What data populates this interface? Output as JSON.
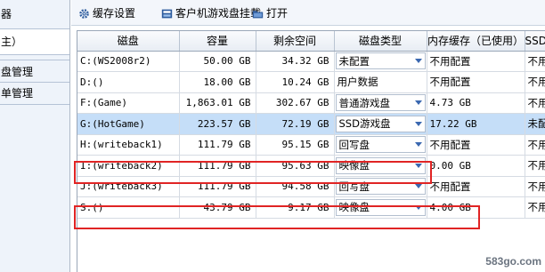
{
  "sidebar": {
    "title_fragment": "器",
    "selected_fragment": "主）",
    "items": [
      {
        "label": "盘管理"
      },
      {
        "label": "单管理"
      }
    ]
  },
  "toolbar": {
    "cache_settings": "缓存设置",
    "client_mount": "客户机游戏盘挂载",
    "open": "打开"
  },
  "grid": {
    "columns": [
      "磁盘",
      "容量",
      "剩余空间",
      "磁盘类型",
      "内存缓存（已使用）",
      "SSD缓存"
    ],
    "rows": [
      {
        "disk": "C:(WS2008r2)",
        "capacity": "50.00 GB",
        "free": "34.32 GB",
        "type": "未配置",
        "type_dropdown": true,
        "mem_cache": "不用配置",
        "ssd_cache": "不用配"
      },
      {
        "disk": "D:()",
        "capacity": "18.00 GB",
        "free": "10.24 GB",
        "type": "用户数据",
        "type_dropdown": false,
        "mem_cache": "不用配置",
        "ssd_cache": "不用配"
      },
      {
        "disk": "F:(Game)",
        "capacity": "1,863.01 GB",
        "free": "302.67 GB",
        "type": "普通游戏盘",
        "type_dropdown": true,
        "mem_cache": "4.73 GB",
        "ssd_cache": "不用配"
      },
      {
        "disk": "G:(HotGame)",
        "capacity": "223.57 GB",
        "free": "72.19 GB",
        "type": "SSD游戏盘",
        "type_dropdown": true,
        "mem_cache": "17.22 GB",
        "ssd_cache": "未配置",
        "selected": true
      },
      {
        "disk": "H:(writeback1)",
        "capacity": "111.79 GB",
        "free": "95.15 GB",
        "type": "回写盘",
        "type_dropdown": true,
        "mem_cache": "不用配置",
        "ssd_cache": "不用配"
      },
      {
        "disk": "I:(writeback2)",
        "capacity": "111.79 GB",
        "free": "95.63 GB",
        "type": "映像盘",
        "type_dropdown": true,
        "mem_cache": "0.00 GB",
        "ssd_cache": "不用配"
      },
      {
        "disk": "J:(writeback3)",
        "capacity": "111.79 GB",
        "free": "94.58 GB",
        "type": "回写盘",
        "type_dropdown": true,
        "mem_cache": "不用配置",
        "ssd_cache": "不用配"
      },
      {
        "disk": "S:()",
        "capacity": "43.79 GB",
        "free": "9.17 GB",
        "type": "映像盘",
        "type_dropdown": true,
        "mem_cache": "4.00 GB",
        "ssd_cache": "不用配"
      }
    ]
  },
  "icons": [
    "gear-icon",
    "client-mount-icon",
    "folder-icon",
    "dropdown-caret-icon"
  ],
  "colors": {
    "selected_row": "#c5def8",
    "highlight": "#e02424",
    "accent": "#3a68b0"
  },
  "watermark": "583go.com"
}
